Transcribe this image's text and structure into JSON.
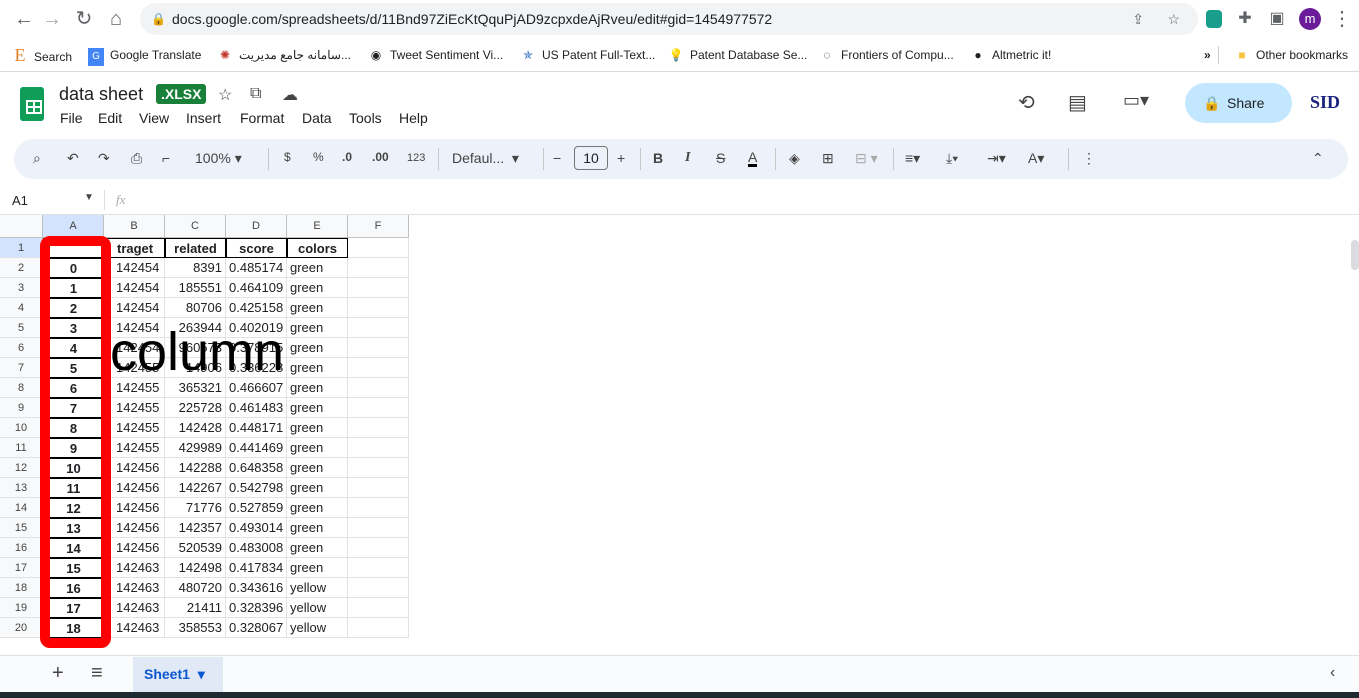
{
  "browser": {
    "url": "docs.google.com/spreadsheets/d/11Bnd97ZiEcKtQquPjAD9zcpxdeAjRveu/edit#gid=1454977572",
    "profile_initial": "m",
    "bookmarks": [
      "Search",
      "Google Translate",
      "سامانه جامع مدیریت...",
      "Tweet Sentiment Vi...",
      "US Patent Full-Text...",
      "Patent Database Se...",
      "Frontiers of Compu...",
      "Altmetric it!"
    ],
    "more": "»",
    "other_bookmarks": "Other bookmarks"
  },
  "app": {
    "title": "data sheet",
    "badge": ".XLSX",
    "menu": [
      "File",
      "Edit",
      "View",
      "Insert",
      "Format",
      "Data",
      "Tools",
      "Help"
    ],
    "share_label": "Share",
    "brand": "SID"
  },
  "toolbar": {
    "zoom": "100%",
    "currency": "$",
    "percent": "%",
    "dec_less": ".0",
    "dec_more": ".00",
    "format_123": "123",
    "font": "Defaul...",
    "font_size": "10",
    "bold": "B",
    "italic": "I"
  },
  "formula_bar": {
    "cell_ref": "A1",
    "fx": "fx",
    "value": ""
  },
  "grid": {
    "columns": [
      "A",
      "B",
      "C",
      "D",
      "E",
      "F"
    ],
    "header_row": [
      "",
      "traget",
      "related",
      "score",
      "colors"
    ],
    "rows": [
      [
        "0",
        "142454",
        "8391",
        "0.485174",
        "green"
      ],
      [
        "1",
        "142454",
        "185551",
        "0.464109",
        "green"
      ],
      [
        "2",
        "142454",
        "80706",
        "0.425158",
        "green"
      ],
      [
        "3",
        "142454",
        "263944",
        "0.402019",
        "green"
      ],
      [
        "4",
        "142454",
        "960573",
        "0.378915",
        "green"
      ],
      [
        "5",
        "142455",
        "14906",
        "0.336228",
        "green"
      ],
      [
        "6",
        "142455",
        "365321",
        "0.466607",
        "green"
      ],
      [
        "7",
        "142455",
        "225728",
        "0.461483",
        "green"
      ],
      [
        "8",
        "142455",
        "142428",
        "0.448171",
        "green"
      ],
      [
        "9",
        "142455",
        "429989",
        "0.441469",
        "green"
      ],
      [
        "10",
        "142456",
        "142288",
        "0.648358",
        "green"
      ],
      [
        "11",
        "142456",
        "142267",
        "0.542798",
        "green"
      ],
      [
        "12",
        "142456",
        "71776",
        "0.527859",
        "green"
      ],
      [
        "13",
        "142456",
        "142357",
        "0.493014",
        "green"
      ],
      [
        "14",
        "142456",
        "520539",
        "0.483008",
        "green"
      ],
      [
        "15",
        "142463",
        "142498",
        "0.417834",
        "green"
      ],
      [
        "16",
        "142463",
        "480720",
        "0.343616",
        "yellow"
      ],
      [
        "17",
        "142463",
        "21411",
        "0.328396",
        "yellow"
      ],
      [
        "18",
        "142463",
        "358553",
        "0.328067",
        "yellow"
      ]
    ]
  },
  "annotation": {
    "text": "column",
    "color": "#ff0000"
  },
  "sheets": {
    "tabs": [
      "Sheet1"
    ],
    "add": "+",
    "list": "≡"
  }
}
